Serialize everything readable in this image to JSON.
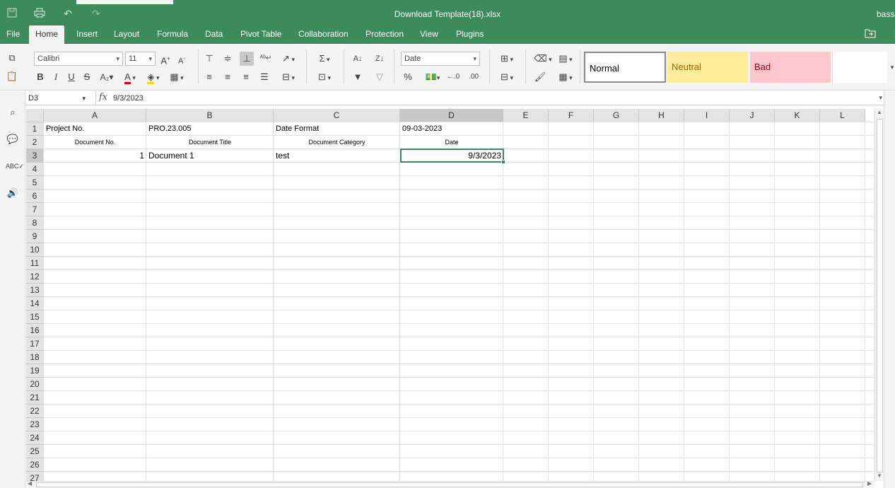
{
  "titlebar": {
    "title": "Download Template(18).xlsx",
    "user": "bassa"
  },
  "menu": {
    "items": [
      "File",
      "Home",
      "Insert",
      "Layout",
      "Formula",
      "Data",
      "Pivot Table",
      "Collaboration",
      "Protection",
      "View",
      "Plugins"
    ],
    "active": "Home"
  },
  "toolbar": {
    "font_name": "Calibri",
    "font_size": "11",
    "number_format": "Date"
  },
  "styles": {
    "normal": "Normal",
    "neutral": "Neutral",
    "bad": "Bad",
    "normal_color": "#ffffff",
    "neutral_color": "#ffeb9c",
    "bad_color": "#ffc7ce"
  },
  "formula_bar": {
    "name_box": "D3",
    "fx": "fx",
    "value": "9/3/2023"
  },
  "sheet": {
    "columns": [
      "A",
      "B",
      "C",
      "D",
      "E",
      "F",
      "G",
      "H",
      "I",
      "J",
      "K",
      "L"
    ],
    "rows": [
      "1",
      "2",
      "3",
      "4",
      "5",
      "6",
      "7",
      "8",
      "9",
      "10",
      "11",
      "12",
      "13",
      "14",
      "15",
      "16",
      "17",
      "18",
      "19",
      "20",
      "21",
      "22",
      "23",
      "24",
      "25",
      "26",
      "27"
    ],
    "selected_cell": "D3",
    "cells": {
      "A1": "Project No.",
      "B1": "PRO.23.005",
      "C1": "Date Format",
      "D1": "09-03-2023",
      "A2": "Document No.",
      "B2": "Document Title",
      "C2": "Document Category",
      "D2": "Date",
      "A3": "1",
      "B3": "Document 1",
      "C3": "test",
      "D3": "9/3/2023"
    }
  }
}
